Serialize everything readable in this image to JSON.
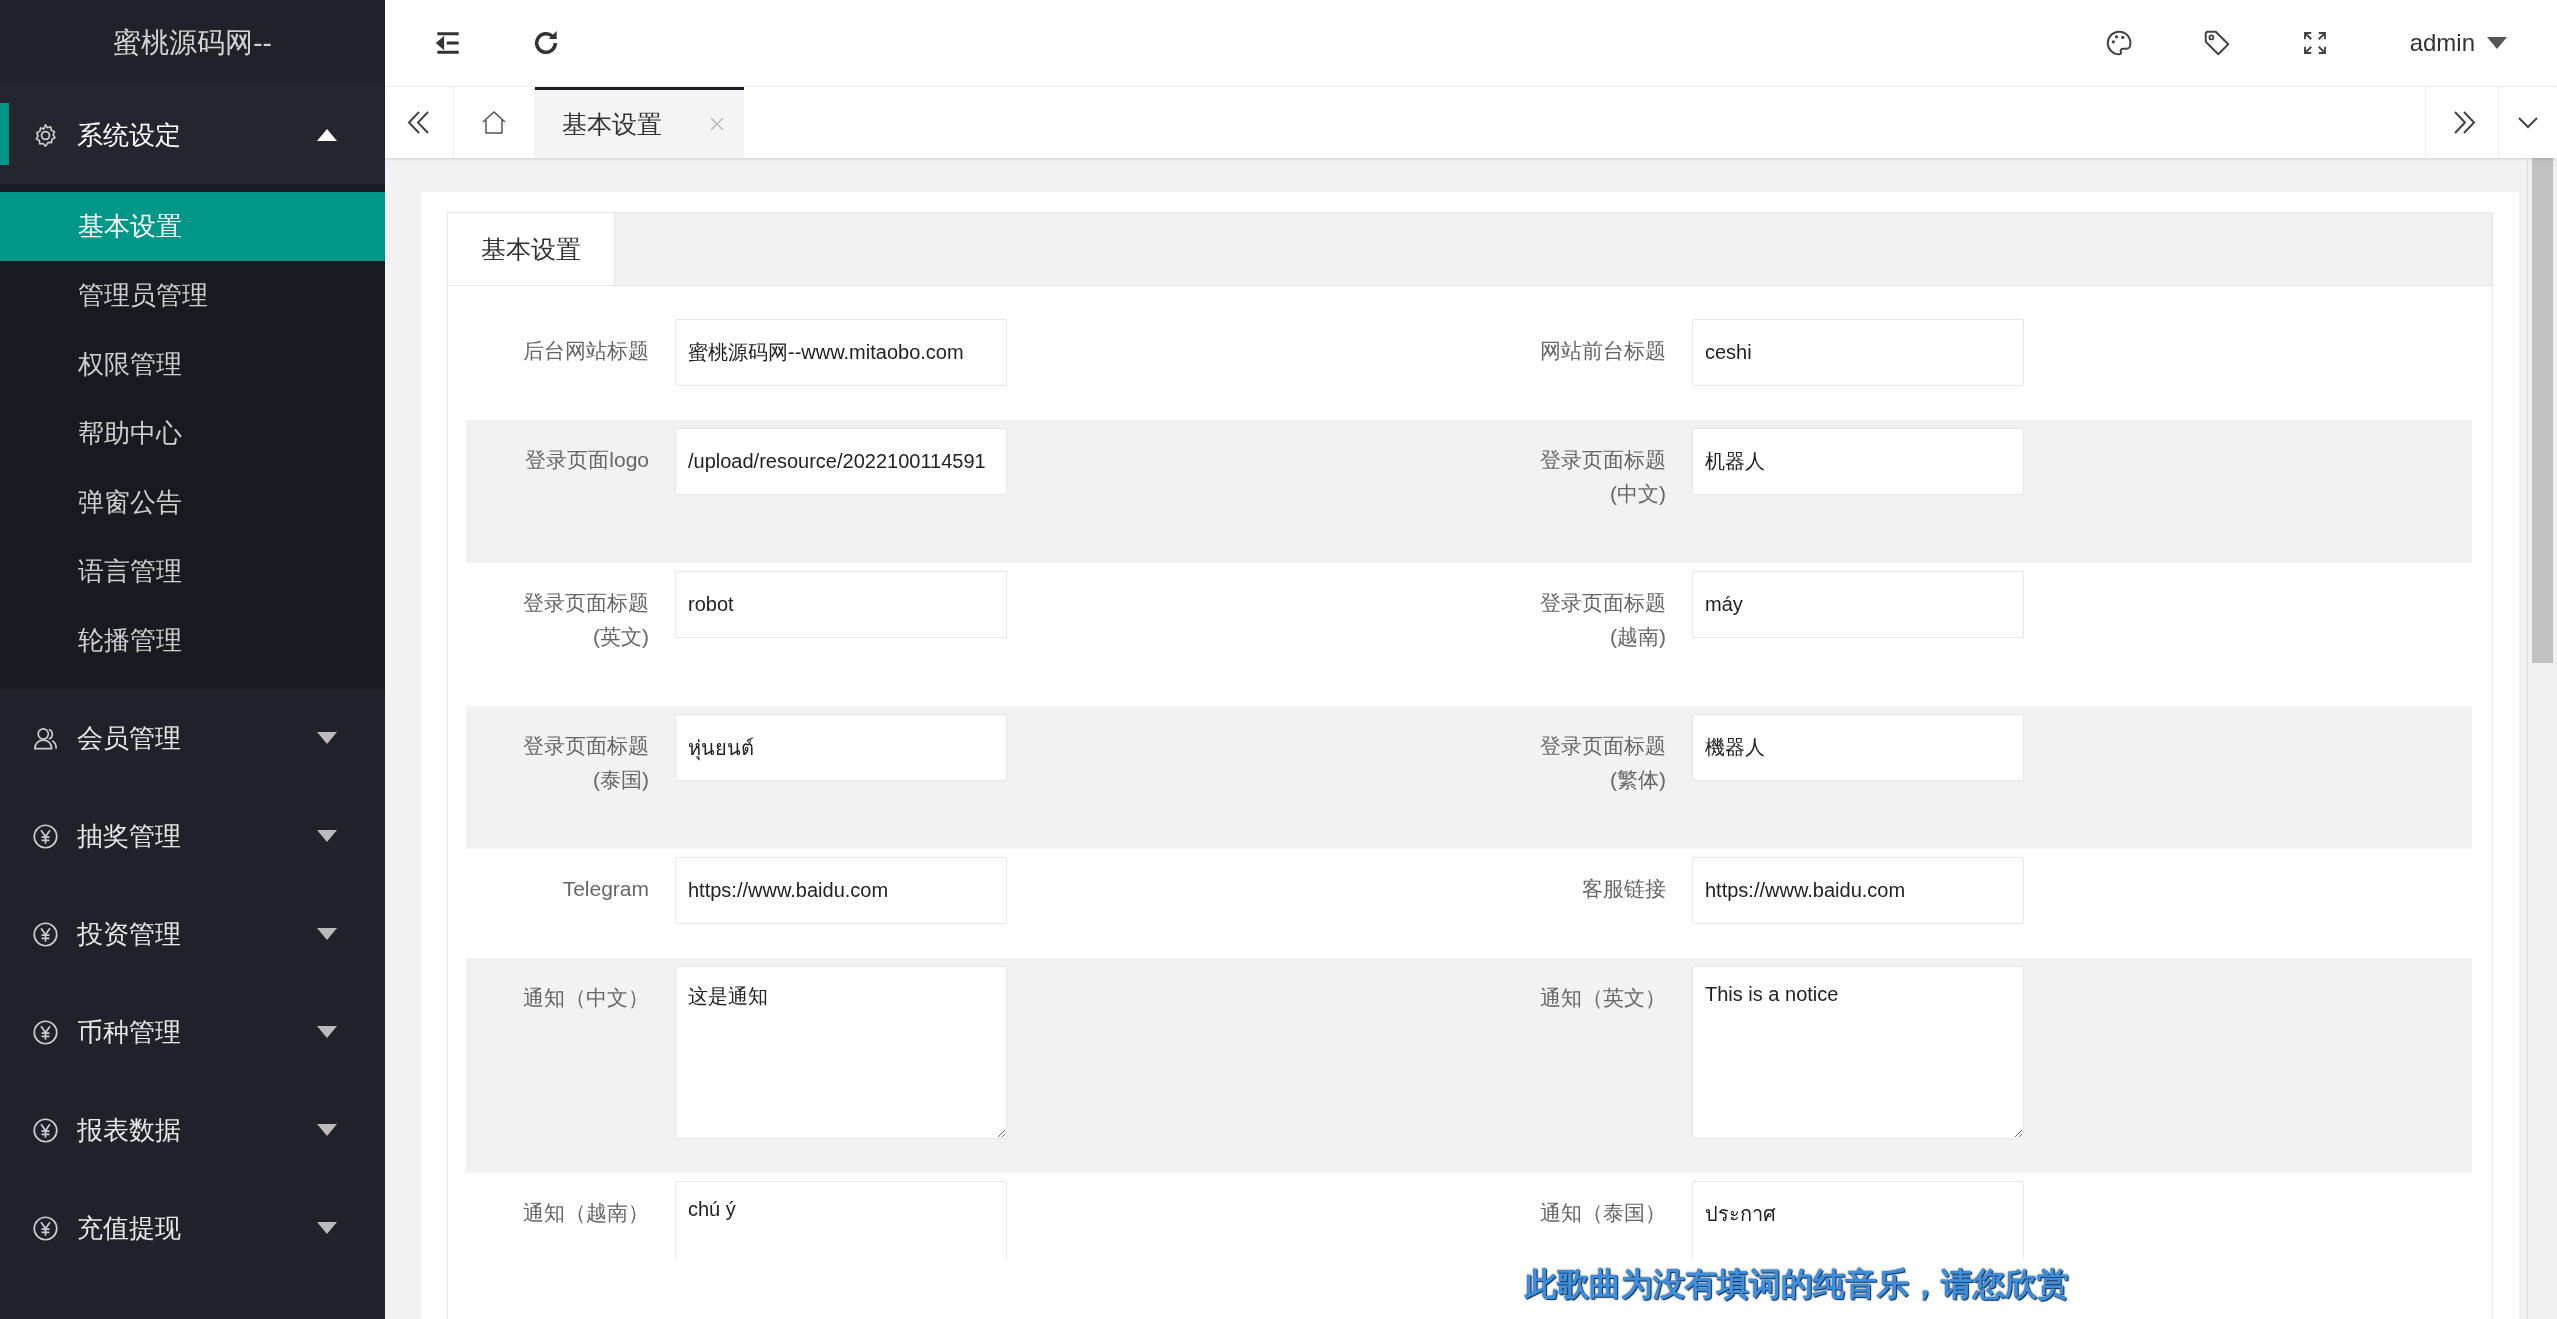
{
  "sidebar": {
    "logo": "蜜桃源码网--",
    "menu": [
      {
        "label": "系统设定",
        "kind": "gear",
        "expanded": true,
        "children": [
          {
            "label": "基本设置",
            "selected": true
          },
          {
            "label": "管理员管理",
            "selected": false
          },
          {
            "label": "权限管理",
            "selected": false
          },
          {
            "label": "帮助中心",
            "selected": false
          },
          {
            "label": "弹窗公告",
            "selected": false
          },
          {
            "label": "语言管理",
            "selected": false
          },
          {
            "label": "轮播管理",
            "selected": false
          }
        ]
      },
      {
        "label": "会员管理",
        "kind": "user",
        "expanded": false
      },
      {
        "label": "抽奖管理",
        "kind": "yen",
        "expanded": false
      },
      {
        "label": "投资管理",
        "kind": "yen",
        "expanded": false
      },
      {
        "label": "币种管理",
        "kind": "yen",
        "expanded": false
      },
      {
        "label": "报表数据",
        "kind": "yen",
        "expanded": false
      },
      {
        "label": "充值提现",
        "kind": "yen",
        "expanded": false
      }
    ]
  },
  "topbar": {
    "user": "admin"
  },
  "tabs": [
    {
      "label": "基本设置",
      "selected": true
    }
  ],
  "form": {
    "tabs": [
      {
        "label": "基本设置",
        "selected": true
      }
    ],
    "rows": [
      [
        {
          "label": "后台网站标题",
          "kind": "input",
          "value": "蜜桃源码网--www.mitaobo.com"
        },
        {
          "label": "网站前台标题",
          "kind": "input",
          "value": "ceshi"
        }
      ],
      [
        {
          "label": "登录页面logo",
          "kind": "input",
          "value": "/upload/resource/2022100114591"
        },
        {
          "label": "登录页面标题",
          "note": "(中文)",
          "kind": "input",
          "value": "机器人"
        }
      ],
      [
        {
          "label": "登录页面标题",
          "note": "(英文)",
          "kind": "input",
          "value": "robot"
        },
        {
          "label": "登录页面标题",
          "note": "(越南)",
          "kind": "input",
          "value": "máy"
        }
      ],
      [
        {
          "label": "登录页面标题",
          "note": "(泰国)",
          "kind": "input",
          "value": "หุ่นยนต์"
        },
        {
          "label": "登录页面标题",
          "note": "(繁体)",
          "kind": "input",
          "value": "機器人"
        }
      ],
      [
        {
          "label": "Telegram",
          "kind": "input",
          "value": "https://www.baidu.com"
        },
        {
          "label": "客服链接",
          "kind": "input",
          "value": "https://www.baidu.com"
        }
      ],
      [
        {
          "label": "通知（中文）",
          "kind": "textarea",
          "value": "这是通知"
        },
        {
          "label": "通知（英文）",
          "kind": "textarea",
          "value": "This is a notice"
        }
      ],
      [
        {
          "label": "通知（越南）",
          "kind": "textarea",
          "value": "chú ý"
        },
        {
          "label": "通知（泰国）",
          "kind": "textarea",
          "value": "ประกาศ"
        }
      ]
    ]
  },
  "lyrics": "此歌曲为没有填词的纯音乐，请您欣赏"
}
